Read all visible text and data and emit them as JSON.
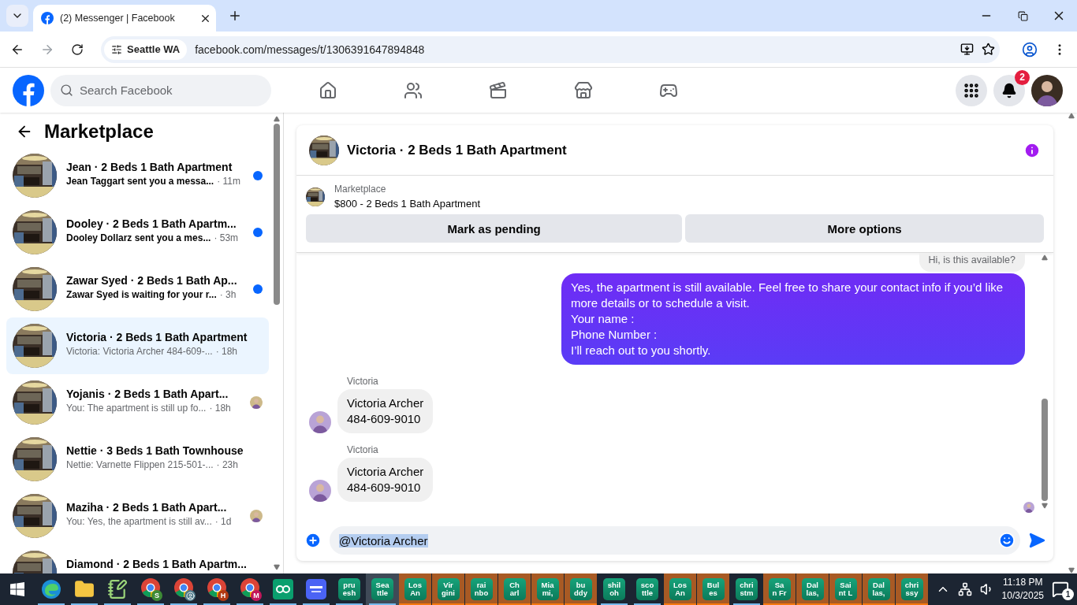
{
  "browser": {
    "tab_title": "(2) Messenger | Facebook",
    "location_chip": "Seattle WA",
    "url": "facebook.com/messages/t/1306391647894848"
  },
  "header": {
    "search_placeholder": "Search Facebook",
    "notification_count": "2"
  },
  "sidebar": {
    "title": "Marketplace",
    "conversations": [
      {
        "title": "Jean · 2 Beds 1 Bath Apartment",
        "preview": "Jean Taggart sent you a messa...",
        "time": "· 11m",
        "unread": true,
        "selected": false,
        "seen": false
      },
      {
        "title": "Dooley · 2 Beds 1 Bath Apartm...",
        "preview": "Dooley Dollarz sent you a mes...",
        "time": "· 53m",
        "unread": true,
        "selected": false,
        "seen": false
      },
      {
        "title": "Zawar Syed · 2 Beds 1 Bath Ap...",
        "preview": "Zawar Syed is waiting for your r...",
        "time": "· 3h",
        "unread": true,
        "selected": false,
        "seen": false
      },
      {
        "title": "Victoria · 2 Beds 1 Bath Apartment",
        "preview": "Victoria: Victoria Archer 484-609-...",
        "time": "· 18h",
        "unread": false,
        "selected": true,
        "seen": false
      },
      {
        "title": "Yojanis · 2 Beds 1 Bath Apart...",
        "preview": "You: The apartment is still up fo...",
        "time": "· 18h",
        "unread": false,
        "selected": false,
        "seen": true
      },
      {
        "title": "Nettie · 3 Beds 1 Bath Townhouse",
        "preview": "Nettie: Varnette Flippen 215-501-...",
        "time": "· 23h",
        "unread": false,
        "selected": false,
        "seen": false
      },
      {
        "title": "Maziha · 2 Beds 1 Bath Apart...",
        "preview": "You: Yes, the apartment is still av...",
        "time": "· 1d",
        "unread": false,
        "selected": false,
        "seen": true
      },
      {
        "title": "Diamond · 2 Beds 1 Bath Apartm...",
        "selected": false
      }
    ]
  },
  "chat": {
    "title": "Victoria · 2 Beds 1 Bath Apartment",
    "listing": {
      "label": "Marketplace",
      "name": "$800 - 2 Beds 1 Bath Apartment"
    },
    "actions": [
      "Mark as pending",
      "More options"
    ],
    "messages": [
      {
        "kind": "quote",
        "text": "Hi, is this available?"
      },
      {
        "kind": "outgoing",
        "text": "Yes, the apartment is still available. Feel free to share your contact info if you’d like more details or to schedule a visit.\nYour name :\nPhone Number :\nI’ll reach out to you shortly."
      },
      {
        "kind": "incoming",
        "sender": "Victoria",
        "text": "Victoria Archer\n484-609-9010"
      },
      {
        "kind": "incoming",
        "sender": "Victoria",
        "text": "Victoria Archer\n484-609-9010"
      }
    ],
    "composer": {
      "value": "@Victoria Archer",
      "value_highlighted": true
    }
  },
  "taskbar": {
    "apps": [
      {
        "kind": "edge",
        "running": true
      },
      {
        "kind": "folder",
        "running": true
      },
      {
        "kind": "notepad",
        "running": true
      },
      {
        "kind": "chrome",
        "badge": "S",
        "color": "#3e8b36",
        "running": true
      },
      {
        "kind": "chrome_profile",
        "running": true
      },
      {
        "kind": "chrome",
        "badge": "H",
        "color": "#b23a12",
        "running": true
      },
      {
        "kind": "chrome",
        "badge": "M",
        "color": "#c2185b",
        "running": true
      },
      {
        "kind": "green_app",
        "running": true
      },
      {
        "kind": "proxy_app",
        "running": true
      }
    ],
    "tiles": [
      {
        "label": "pru\nesh",
        "running": true,
        "flashing": false,
        "selected": false
      },
      {
        "label": "Sea\nttle",
        "running": true,
        "flashing": false,
        "selected": true
      },
      {
        "label": "Los\nAn",
        "running": false,
        "flashing": true,
        "selected": false
      },
      {
        "label": "Vir\ngini",
        "running": false,
        "flashing": true,
        "selected": false
      },
      {
        "label": "rai\nnbo",
        "running": false,
        "flashing": true,
        "selected": false
      },
      {
        "label": "Ch\narl",
        "running": false,
        "flashing": true,
        "selected": false
      },
      {
        "label": "Mia\nmi,",
        "running": false,
        "flashing": true,
        "selected": false
      },
      {
        "label": "bu\nddy",
        "running": false,
        "flashing": true,
        "selected": false
      },
      {
        "label": "shil\noh",
        "running": true,
        "flashing": false,
        "selected": false
      },
      {
        "label": "sco\nttle",
        "running": true,
        "flashing": false,
        "selected": false
      },
      {
        "label": "Los\nAn",
        "running": false,
        "flashing": true,
        "selected": false
      },
      {
        "label": "Bul\nes",
        "running": false,
        "flashing": true,
        "selected": false
      },
      {
        "label": "chri\nstm",
        "running": true,
        "flashing": false,
        "selected": false
      },
      {
        "label": "Sa\nn Fr",
        "running": false,
        "flashing": true,
        "selected": false
      },
      {
        "label": "Dal\nlas,",
        "running": false,
        "flashing": true,
        "selected": false
      },
      {
        "label": "Sai\nnt L",
        "running": false,
        "flashing": true,
        "selected": false
      },
      {
        "label": "Dal\nlas,",
        "running": false,
        "flashing": true,
        "selected": false
      },
      {
        "label": "chri\nssy",
        "running": false,
        "flashing": true,
        "selected": false
      }
    ],
    "clock": {
      "time": "11:18 PM",
      "date": "10/3/2025"
    },
    "notification_count": "1"
  }
}
